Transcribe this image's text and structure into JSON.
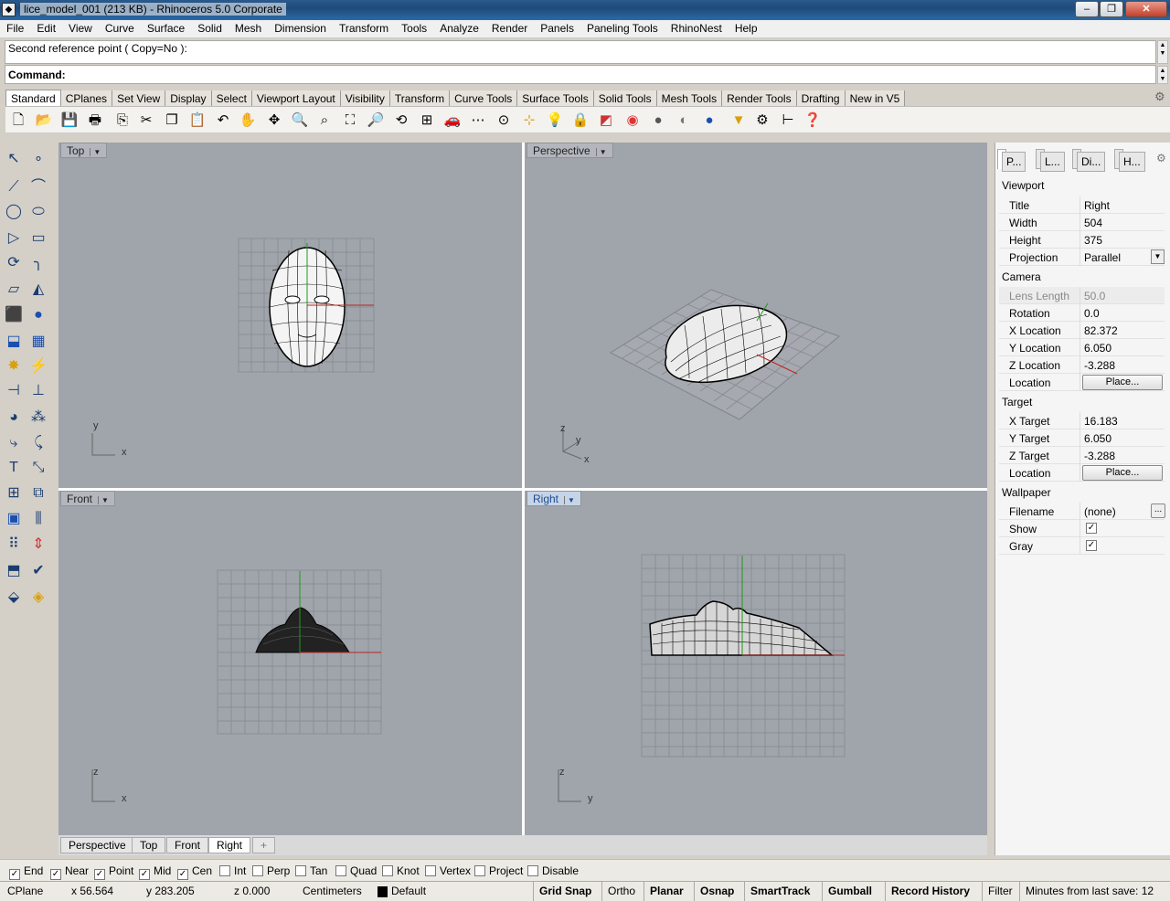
{
  "window": {
    "title": "lice_model_001 (213 KB) - Rhinoceros  5.0 Corporate",
    "minimize": "‒",
    "maximize": "❐",
    "close": "✕"
  },
  "menu": [
    "File",
    "Edit",
    "View",
    "Curve",
    "Surface",
    "Solid",
    "Mesh",
    "Dimension",
    "Transform",
    "Tools",
    "Analyze",
    "Render",
    "Panels",
    "Paneling Tools",
    "RhinoNest",
    "Help"
  ],
  "command": {
    "history": "Second reference point ( Copy=No ):",
    "prompt": "Command:"
  },
  "toolbar_tabs": [
    "Standard",
    "CPlanes",
    "Set View",
    "Display",
    "Select",
    "Viewport Layout",
    "Visibility",
    "Transform",
    "Curve Tools",
    "Surface Tools",
    "Solid Tools",
    "Mesh Tools",
    "Render Tools",
    "Drafting",
    "New in V5"
  ],
  "viewports": {
    "top": {
      "title": "Top",
      "axis_h": "x",
      "axis_v": "y"
    },
    "perspective": {
      "title": "Perspective",
      "axis_h": "x",
      "axis_v": "z",
      "axis_d": "y"
    },
    "front": {
      "title": "Front",
      "axis_h": "x",
      "axis_v": "z"
    },
    "right": {
      "title": "Right",
      "axis_h": "y",
      "axis_v": "z"
    }
  },
  "panel": {
    "tabs": [
      "P...",
      "L...",
      "Di...",
      "H..."
    ],
    "viewport_section": "Viewport",
    "title_label": "Title",
    "title_value": "Right",
    "width_label": "Width",
    "width_value": "504",
    "height_label": "Height",
    "height_value": "375",
    "projection_label": "Projection",
    "projection_value": "Parallel",
    "camera_section": "Camera",
    "lens_label": "Lens Length",
    "lens_value": "50.0",
    "rotation_label": "Rotation",
    "rotation_value": "0.0",
    "xloc_label": "X Location",
    "xloc_value": "82.372",
    "yloc_label": "Y Location",
    "yloc_value": "6.050",
    "zloc_label": "Z Location",
    "zloc_value": "-3.288",
    "location_label": "Location",
    "place_button": "Place...",
    "target_section": "Target",
    "xt_label": "X Target",
    "xt_value": "16.183",
    "yt_label": "Y Target",
    "yt_value": "6.050",
    "zt_label": "Z Target",
    "zt_value": "-3.288",
    "tloc_label": "Location",
    "wallpaper_section": "Wallpaper",
    "filename_label": "Filename",
    "filename_value": "(none)",
    "browse": "...",
    "show_label": "Show",
    "gray_label": "Gray"
  },
  "view_tabs": [
    "Perspective",
    "Top",
    "Front",
    "Right",
    "+"
  ],
  "osnaps": [
    {
      "label": "End",
      "checked": true
    },
    {
      "label": "Near",
      "checked": true
    },
    {
      "label": "Point",
      "checked": true
    },
    {
      "label": "Mid",
      "checked": true
    },
    {
      "label": "Cen",
      "checked": true
    },
    {
      "label": "Int",
      "checked": false
    },
    {
      "label": "Perp",
      "checked": false
    },
    {
      "label": "Tan",
      "checked": false
    },
    {
      "label": "Quad",
      "checked": false
    },
    {
      "label": "Knot",
      "checked": false
    },
    {
      "label": "Vertex",
      "checked": false
    },
    {
      "label": "Project",
      "checked": false
    },
    {
      "label": "Disable",
      "checked": false
    }
  ],
  "status": {
    "cplane": "CPlane",
    "x": "x 56.564",
    "y": "y 283.205",
    "z": "z 0.000",
    "units": "Centimeters",
    "layer": "Default",
    "grid_snap": "Grid Snap",
    "ortho": "Ortho",
    "planar": "Planar",
    "osnap": "Osnap",
    "smarttrack": "SmartTrack",
    "gumball": "Gumball",
    "record_history": "Record History",
    "filter": "Filter",
    "save_info": "Minutes from last save: 12"
  }
}
